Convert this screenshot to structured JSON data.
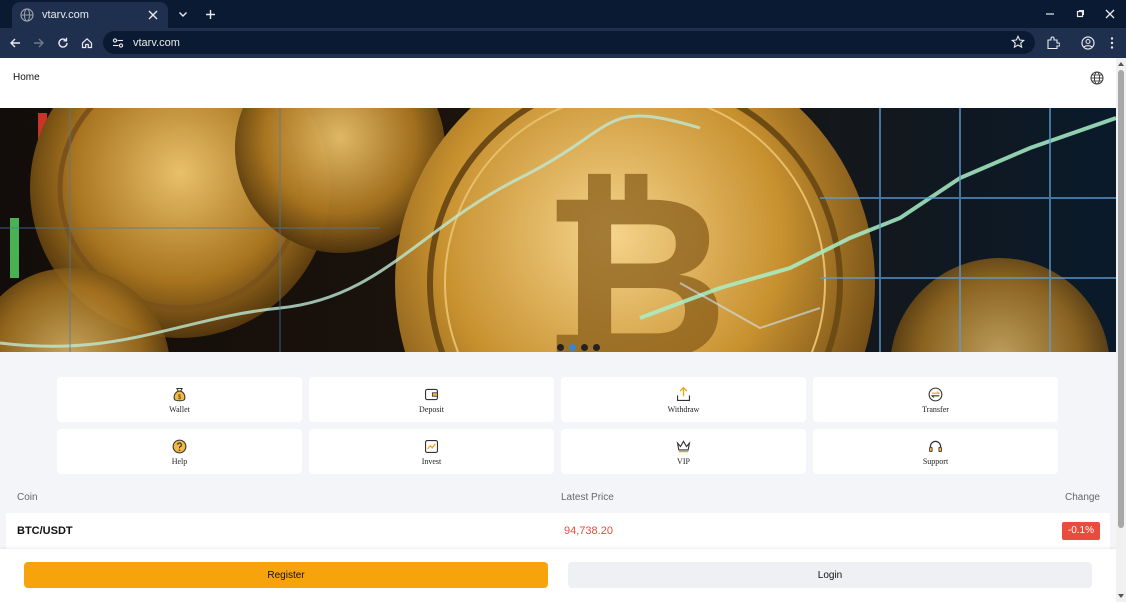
{
  "browser": {
    "tab_title": "vtarv.com",
    "url": "vtarv.com"
  },
  "header": {
    "home_label": "Home"
  },
  "banner": {
    "slides_total": 4,
    "active_slide": 2
  },
  "menu": [
    {
      "label": "Wallet",
      "icon": "money-bag-icon"
    },
    {
      "label": "Deposit",
      "icon": "wallet-icon"
    },
    {
      "label": "Withdraw",
      "icon": "upload-tray-icon"
    },
    {
      "label": "Transfer",
      "icon": "transfer-circle-icon"
    },
    {
      "label": "Help",
      "icon": "question-circle-icon"
    },
    {
      "label": "Invest",
      "icon": "chart-square-icon"
    },
    {
      "label": "VIP",
      "icon": "crown-icon"
    },
    {
      "label": "Support",
      "icon": "headset-icon"
    }
  ],
  "market": {
    "columns": [
      "Coin",
      "Latest Price",
      "Change"
    ],
    "rows": [
      {
        "coin": "BTC/USDT",
        "price": "94,738.20",
        "change": "-0.1%"
      }
    ]
  },
  "footer": {
    "register_label": "Register",
    "login_label": "Login"
  },
  "colors": {
    "accent": "#f7a40c",
    "negative": "#e74c3c",
    "icon": "#e8a21a"
  }
}
